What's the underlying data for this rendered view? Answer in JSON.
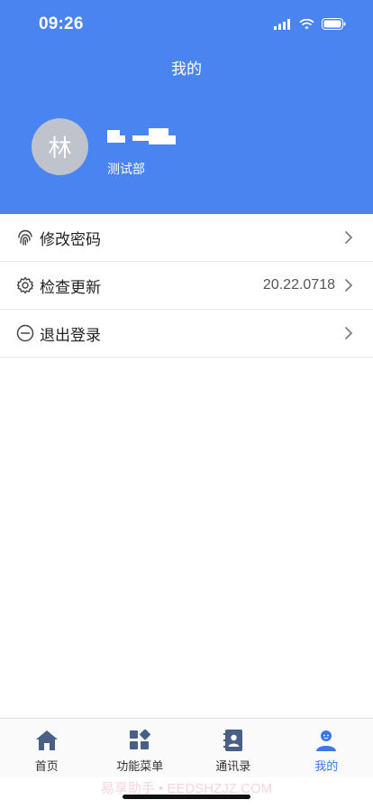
{
  "status_bar": {
    "time": "09:26"
  },
  "header": {
    "title": "我的",
    "avatar_char": "林",
    "department": "测试部"
  },
  "menu": {
    "items": [
      {
        "label": "修改密码",
        "icon": "fingerprint-icon",
        "value": ""
      },
      {
        "label": "检查更新",
        "icon": "gear-icon",
        "value": "20.22.0718"
      },
      {
        "label": "退出登录",
        "icon": "minus-circle-icon",
        "value": ""
      }
    ]
  },
  "tabbar": {
    "tabs": [
      {
        "label": "首页",
        "icon": "home-icon"
      },
      {
        "label": "功能菜单",
        "icon": "grid-menu-icon"
      },
      {
        "label": "通讯录",
        "icon": "contacts-icon"
      },
      {
        "label": "我的",
        "icon": "user-icon"
      }
    ],
    "active_index": 3
  },
  "watermark": "易享助手 • EEDSHZJZ.COM",
  "colors": {
    "header_bg": "#4a84f0",
    "active_tab": "#3a78e8"
  }
}
